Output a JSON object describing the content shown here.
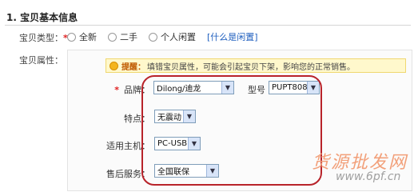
{
  "section": {
    "title": "1. 宝贝基本信息"
  },
  "type_row": {
    "label": "宝贝类型：",
    "required_mark": "*",
    "options": [
      "全新",
      "二手",
      "个人闲置"
    ],
    "link": "[什么是闲置]"
  },
  "attr_row": {
    "label": "宝贝属性："
  },
  "tip": {
    "title": "提醒：",
    "text": "填错宝贝属性，可能会引起宝贝下架，影响您的正常销售。"
  },
  "fields": {
    "brand": {
      "label": "品牌：",
      "required_mark": "*",
      "value": "Dilong/迪龙"
    },
    "model": {
      "label": "型号",
      "value": "PUPT808"
    },
    "feature": {
      "label": "特点：",
      "value": "无震动"
    },
    "host": {
      "label": "适用主机：",
      "value": "PC-USB"
    },
    "service": {
      "label": "售后服务：",
      "value": "全国联保"
    }
  },
  "watermark": {
    "text_cn": "货源批发网",
    "url": "www.6pf.cn"
  },
  "colors": {
    "accent_red": "#b8232a",
    "link_blue": "#1f5fbf",
    "tip_bg": "#fff8cc"
  },
  "icons": {
    "tip": "lightbulb-icon",
    "dropdown": "chevron-down-icon",
    "radio": "radio-unchecked-icon"
  }
}
